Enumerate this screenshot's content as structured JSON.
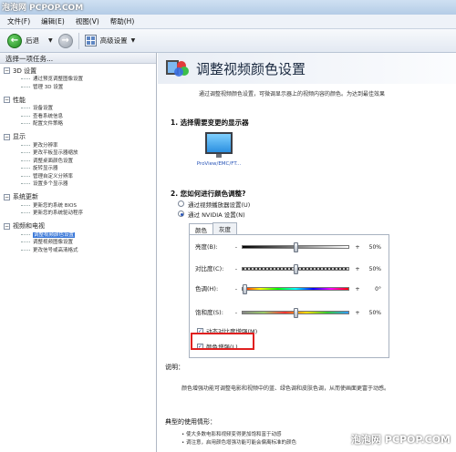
{
  "watermark": {
    "top": "泡泡网 PCPOP.COM",
    "bottom": "泡泡网 PCPOP.COM"
  },
  "menu": [
    "文件(F)",
    "编辑(E)",
    "视图(V)",
    "帮助(H)"
  ],
  "toolbar": {
    "back_label": "后退",
    "advanced_label": "高级设置"
  },
  "sidebar": {
    "header": "选择一项任务...",
    "categories": [
      {
        "toggle": "−",
        "label": "3D 设置",
        "items": [
          "通过预览调整图像设置",
          "管理 3D 设置"
        ]
      },
      {
        "toggle": "−",
        "label": "性能",
        "items": [
          "设备设置",
          "查看系统信息",
          "配置文件策略"
        ]
      },
      {
        "toggle": "−",
        "label": "显示",
        "items": [
          "更改分辨率",
          "更改平板显示器缩放",
          "调整桌面颜色设置",
          "旋转显示器",
          "管理自定义分辨率",
          "设置多个显示器"
        ]
      },
      {
        "toggle": "−",
        "label": "系统更新",
        "items": [
          "更新您的系统 BIOS",
          "更新您的系统驱动程序"
        ]
      },
      {
        "toggle": "−",
        "label": "视频和电视",
        "items": [
          "调整视频颜色设置",
          "调整视频图像设置",
          "更改信号或高清格式"
        ]
      }
    ],
    "selected_item": "调整视频颜色设置"
  },
  "main": {
    "title": "调整视频颜色设置",
    "description": "通过调整视频颜色设置，可微调显示器上的视频内容的颜色。为达到最佳效果",
    "section1": "1.  选择需要变更的显示器",
    "monitor_label": "ProView/EMC/FT...",
    "section2": "2.  您如何进行颜色调整?",
    "radio_player": "通过视频播放器设置(U)",
    "radio_nvidia": "通过 NVIDIA 设置(N)",
    "tabs": [
      "颜色",
      "灰度"
    ],
    "sliders": [
      {
        "label": "亮度(B):",
        "value": "50%",
        "level": 0.5
      },
      {
        "label": "对比度(C):",
        "value": "50%",
        "level": 0.5
      },
      {
        "label": "色调(H):",
        "value": "0°",
        "level": 0.0
      },
      {
        "label": "饱和度(S):",
        "value": "50%",
        "level": 0.5
      }
    ],
    "dynamic_contrast": "动态对比度增强(M)",
    "color_enhance": "颜色增强(L)",
    "help_heading": "说明：",
    "help_text": "颜色增强功能可调整电影和视频中的蓝、绿色调和皮肤色调，从而使画面更富于动感。",
    "usage_heading": "典型的使用情形：",
    "usage_items": [
      "• 使大多数电影和视频变得更加饱和富于动感",
      "• 调注意，启用颜色增强功能可能会偏离标准的颜色"
    ]
  }
}
